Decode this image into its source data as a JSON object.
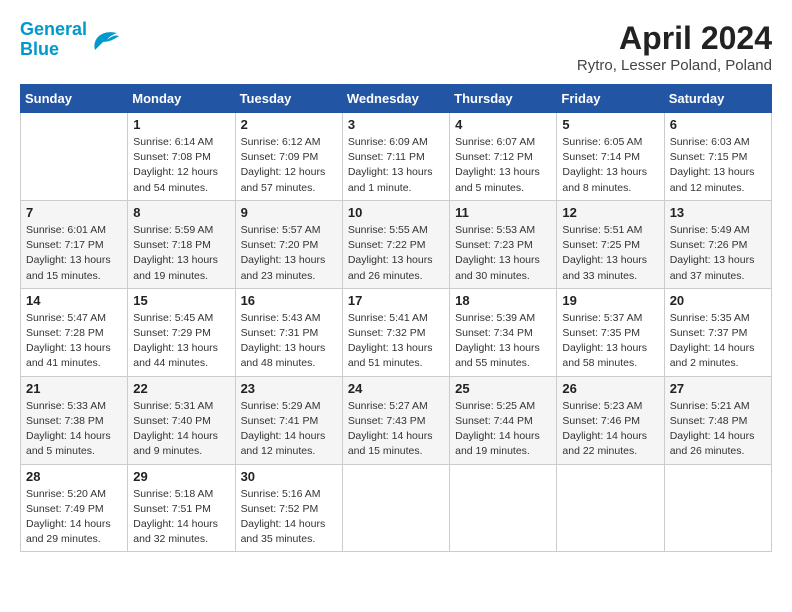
{
  "header": {
    "logo_line1": "General",
    "logo_line2": "Blue",
    "month_title": "April 2024",
    "location": "Rytro, Lesser Poland, Poland"
  },
  "days_of_week": [
    "Sunday",
    "Monday",
    "Tuesday",
    "Wednesday",
    "Thursday",
    "Friday",
    "Saturday"
  ],
  "weeks": [
    [
      {
        "num": "",
        "info": ""
      },
      {
        "num": "1",
        "info": "Sunrise: 6:14 AM\nSunset: 7:08 PM\nDaylight: 12 hours\nand 54 minutes."
      },
      {
        "num": "2",
        "info": "Sunrise: 6:12 AM\nSunset: 7:09 PM\nDaylight: 12 hours\nand 57 minutes."
      },
      {
        "num": "3",
        "info": "Sunrise: 6:09 AM\nSunset: 7:11 PM\nDaylight: 13 hours\nand 1 minute."
      },
      {
        "num": "4",
        "info": "Sunrise: 6:07 AM\nSunset: 7:12 PM\nDaylight: 13 hours\nand 5 minutes."
      },
      {
        "num": "5",
        "info": "Sunrise: 6:05 AM\nSunset: 7:14 PM\nDaylight: 13 hours\nand 8 minutes."
      },
      {
        "num": "6",
        "info": "Sunrise: 6:03 AM\nSunset: 7:15 PM\nDaylight: 13 hours\nand 12 minutes."
      }
    ],
    [
      {
        "num": "7",
        "info": "Sunrise: 6:01 AM\nSunset: 7:17 PM\nDaylight: 13 hours\nand 15 minutes."
      },
      {
        "num": "8",
        "info": "Sunrise: 5:59 AM\nSunset: 7:18 PM\nDaylight: 13 hours\nand 19 minutes."
      },
      {
        "num": "9",
        "info": "Sunrise: 5:57 AM\nSunset: 7:20 PM\nDaylight: 13 hours\nand 23 minutes."
      },
      {
        "num": "10",
        "info": "Sunrise: 5:55 AM\nSunset: 7:22 PM\nDaylight: 13 hours\nand 26 minutes."
      },
      {
        "num": "11",
        "info": "Sunrise: 5:53 AM\nSunset: 7:23 PM\nDaylight: 13 hours\nand 30 minutes."
      },
      {
        "num": "12",
        "info": "Sunrise: 5:51 AM\nSunset: 7:25 PM\nDaylight: 13 hours\nand 33 minutes."
      },
      {
        "num": "13",
        "info": "Sunrise: 5:49 AM\nSunset: 7:26 PM\nDaylight: 13 hours\nand 37 minutes."
      }
    ],
    [
      {
        "num": "14",
        "info": "Sunrise: 5:47 AM\nSunset: 7:28 PM\nDaylight: 13 hours\nand 41 minutes."
      },
      {
        "num": "15",
        "info": "Sunrise: 5:45 AM\nSunset: 7:29 PM\nDaylight: 13 hours\nand 44 minutes."
      },
      {
        "num": "16",
        "info": "Sunrise: 5:43 AM\nSunset: 7:31 PM\nDaylight: 13 hours\nand 48 minutes."
      },
      {
        "num": "17",
        "info": "Sunrise: 5:41 AM\nSunset: 7:32 PM\nDaylight: 13 hours\nand 51 minutes."
      },
      {
        "num": "18",
        "info": "Sunrise: 5:39 AM\nSunset: 7:34 PM\nDaylight: 13 hours\nand 55 minutes."
      },
      {
        "num": "19",
        "info": "Sunrise: 5:37 AM\nSunset: 7:35 PM\nDaylight: 13 hours\nand 58 minutes."
      },
      {
        "num": "20",
        "info": "Sunrise: 5:35 AM\nSunset: 7:37 PM\nDaylight: 14 hours\nand 2 minutes."
      }
    ],
    [
      {
        "num": "21",
        "info": "Sunrise: 5:33 AM\nSunset: 7:38 PM\nDaylight: 14 hours\nand 5 minutes."
      },
      {
        "num": "22",
        "info": "Sunrise: 5:31 AM\nSunset: 7:40 PM\nDaylight: 14 hours\nand 9 minutes."
      },
      {
        "num": "23",
        "info": "Sunrise: 5:29 AM\nSunset: 7:41 PM\nDaylight: 14 hours\nand 12 minutes."
      },
      {
        "num": "24",
        "info": "Sunrise: 5:27 AM\nSunset: 7:43 PM\nDaylight: 14 hours\nand 15 minutes."
      },
      {
        "num": "25",
        "info": "Sunrise: 5:25 AM\nSunset: 7:44 PM\nDaylight: 14 hours\nand 19 minutes."
      },
      {
        "num": "26",
        "info": "Sunrise: 5:23 AM\nSunset: 7:46 PM\nDaylight: 14 hours\nand 22 minutes."
      },
      {
        "num": "27",
        "info": "Sunrise: 5:21 AM\nSunset: 7:48 PM\nDaylight: 14 hours\nand 26 minutes."
      }
    ],
    [
      {
        "num": "28",
        "info": "Sunrise: 5:20 AM\nSunset: 7:49 PM\nDaylight: 14 hours\nand 29 minutes."
      },
      {
        "num": "29",
        "info": "Sunrise: 5:18 AM\nSunset: 7:51 PM\nDaylight: 14 hours\nand 32 minutes."
      },
      {
        "num": "30",
        "info": "Sunrise: 5:16 AM\nSunset: 7:52 PM\nDaylight: 14 hours\nand 35 minutes."
      },
      {
        "num": "",
        "info": ""
      },
      {
        "num": "",
        "info": ""
      },
      {
        "num": "",
        "info": ""
      },
      {
        "num": "",
        "info": ""
      }
    ]
  ]
}
